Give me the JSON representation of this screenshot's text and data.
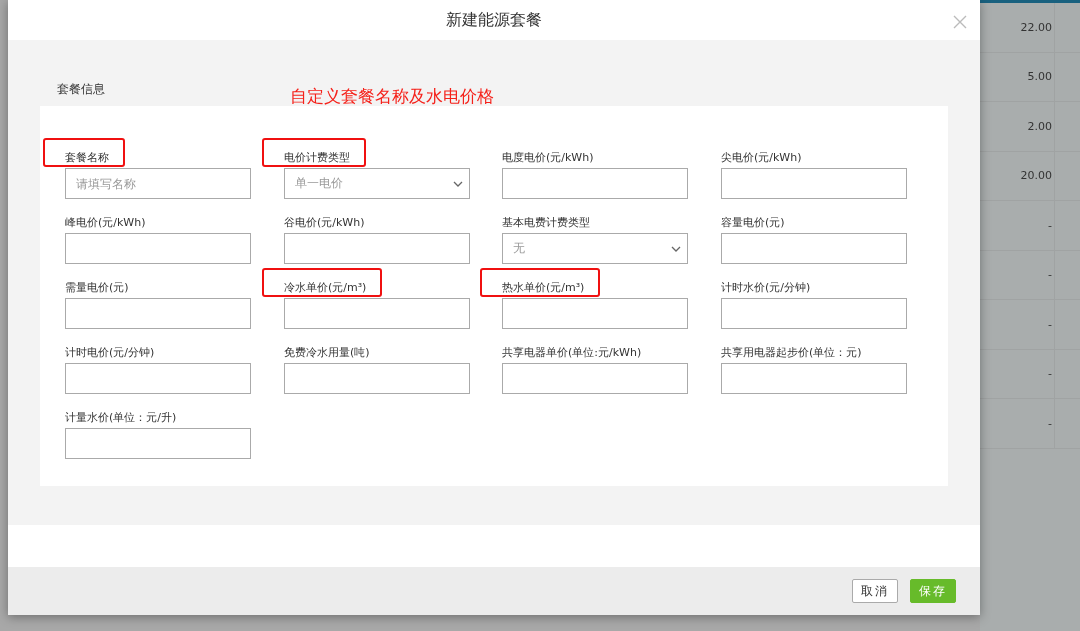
{
  "background_table": {
    "rows": [
      "22.00",
      "5.00",
      "2.00",
      "20.00",
      "-",
      "-",
      "-",
      "-",
      "-"
    ]
  },
  "dialog": {
    "title": "新建能源套餐",
    "section": "套餐信息",
    "annotation": "自定义套餐名称及水电价格",
    "fields": [
      {
        "kind": "text",
        "label": "套餐名称",
        "placeholder": "请填写名称",
        "highlighted": true
      },
      {
        "kind": "select",
        "label": "电价计费类型",
        "value": "单一电价",
        "highlighted": true
      },
      {
        "kind": "text",
        "label": "电度电价(元/kWh)",
        "highlighted": false
      },
      {
        "kind": "text",
        "label": "尖电价(元/kWh)",
        "highlighted": false
      },
      {
        "kind": "text",
        "label": "峰电价(元/kWh)",
        "highlighted": false
      },
      {
        "kind": "text",
        "label": "谷电价(元/kWh)",
        "highlighted": false
      },
      {
        "kind": "select",
        "label": "基本电费计费类型",
        "value": "无",
        "highlighted": false
      },
      {
        "kind": "text",
        "label": "容量电价(元)",
        "highlighted": false
      },
      {
        "kind": "text",
        "label": "需量电价(元)",
        "highlighted": false
      },
      {
        "kind": "text",
        "label": "冷水单价(元/m³)",
        "highlighted": true
      },
      {
        "kind": "text",
        "label": "热水单价(元/m³)",
        "highlighted": true
      },
      {
        "kind": "text",
        "label": "计时水价(元/分钟)",
        "highlighted": false
      },
      {
        "kind": "text",
        "label": "计时电价(元/分钟)",
        "highlighted": false
      },
      {
        "kind": "text",
        "label": "免费冷水用量(吨)",
        "highlighted": false
      },
      {
        "kind": "text",
        "label": "共享电器单价(单位:元/kWh)",
        "highlighted": false
      },
      {
        "kind": "text",
        "label": "共享用电器起步价(单位：元)",
        "highlighted": false
      },
      {
        "kind": "text",
        "label": "计量水价(单位：元/升)",
        "highlighted": false
      }
    ],
    "buttons": [
      {
        "kind": "secondary",
        "label": "取消"
      },
      {
        "kind": "primary",
        "label": "保存"
      }
    ]
  }
}
